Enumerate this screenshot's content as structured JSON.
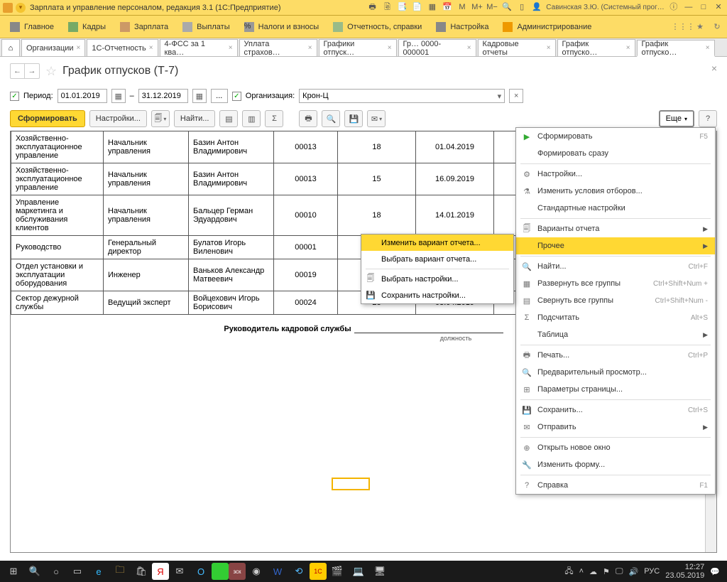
{
  "titlebar": {
    "app": "Зарплата и управление персоналом, редакция 3.1  (1С:Предприятие)",
    "user": "Савинская З.Ю. (Системный прог…"
  },
  "menu": {
    "items": [
      "Главное",
      "Кадры",
      "Зарплата",
      "Выплаты",
      "Налоги и взносы",
      "Отчетность, справки",
      "Настройка",
      "Администрирование"
    ]
  },
  "tabs": [
    "Организации",
    "1С-Отчетность",
    "4-ФСС за 1 ква…",
    "Уплата страхов…",
    "Графики отпуск…",
    "Гр… 0000-000001",
    "Кадровые отчеты",
    "График отпуско…",
    "График отпуско…"
  ],
  "page": {
    "title": "График отпусков (Т-7)"
  },
  "filter": {
    "period_label": "Период:",
    "date_from": "01.01.2019",
    "date_to": "31.12.2019",
    "org_label": "Организация:",
    "org_value": "Крон-Ц"
  },
  "toolbar": {
    "form": "Сформировать",
    "settings": "Настройки...",
    "find": "Найти...",
    "more": "Еще",
    "help": "?"
  },
  "rows": [
    {
      "dept": "Хозяйственно-эксплуатационное управление",
      "pos": "Начальник управления",
      "name": "Базин Антон Владимирович",
      "tab": "00013",
      "days": "18",
      "date": "01.04.2019"
    },
    {
      "dept": "Хозяйственно-эксплуатационное управление",
      "pos": "Начальник управления",
      "name": "Базин Антон Владимирович",
      "tab": "00013",
      "days": "15",
      "date": "16.09.2019"
    },
    {
      "dept": "Управление маркетинга и обслуживания клиентов",
      "pos": "Начальник управления",
      "name": "Бальцер Герман Эдуардович",
      "tab": "00010",
      "days": "18",
      "date": "14.01.2019"
    },
    {
      "dept": "Руководство",
      "pos": "Генеральный директор",
      "name": "Булатов Игорь Виленович",
      "tab": "00001",
      "days": "",
      "date": ""
    },
    {
      "dept": "Отдел установки и эксплуатации оборудования",
      "pos": "Инженер",
      "name": "Ваньков Александр Матвеевич",
      "tab": "00019",
      "days": "",
      "date": ""
    },
    {
      "dept": "Сектор дежурной службы",
      "pos": "Ведущий эксперт",
      "name": "Войцехович Игорь Борисович",
      "tab": "00024",
      "days": "28",
      "date": "03.04.2019"
    }
  ],
  "footer": {
    "head": "Руководитель кадровой службы",
    "sub": "должность"
  },
  "submenu": {
    "i1": "Изменить вариант отчета...",
    "i2": "Выбрать вариант отчета...",
    "i3": "Выбрать настройки...",
    "i4": "Сохранить настройки..."
  },
  "pop": {
    "form": "Сформировать",
    "form_sc": "F5",
    "form_im": "Формировать сразу",
    "settings": "Настройки...",
    "filters": "Изменить условия отборов...",
    "std": "Стандартные настройки",
    "variants": "Варианты отчета",
    "other": "Прочее",
    "find": "Найти...",
    "find_sc": "Ctrl+F",
    "expand": "Развернуть все группы",
    "expand_sc": "Ctrl+Shift+Num +",
    "collapse": "Свернуть все группы",
    "collapse_sc": "Ctrl+Shift+Num -",
    "sum": "Подсчитать",
    "sum_sc": "Alt+S",
    "table": "Таблица",
    "print": "Печать...",
    "print_sc": "Ctrl+P",
    "preview": "Предварительный просмотр...",
    "page": "Параметры страницы...",
    "save": "Сохранить...",
    "save_sc": "Ctrl+S",
    "send": "Отправить",
    "newwin": "Открыть новое окно",
    "editform": "Изменить форму...",
    "help": "Справка",
    "help_sc": "F1"
  },
  "tray": {
    "lang": "РУС",
    "time": "12:27",
    "date": "23.05.2019"
  }
}
